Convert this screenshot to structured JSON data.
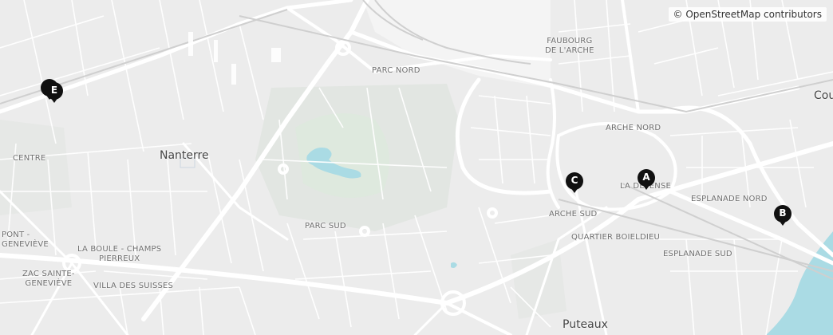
{
  "attribution": "© OpenStreetMap contributors",
  "labels": {
    "faubourg": [
      "FAUBOURG",
      "DE L'ARCHE"
    ],
    "parc_nord": "PARC NORD",
    "arche_nord": "ARCHE NORD",
    "nanterre": "Nanterre",
    "la_defense": "LA DÉFENSE",
    "arche_sud": "ARCHE SUD",
    "esplanade_nord": "ESPLANADE NORD",
    "quartier_boieldieu": "QUARTIER BOIELDIEU",
    "esplanade_sud": "ESPLANADE SUD",
    "parc_sud": "PARC SUD",
    "centre": "CENTRE",
    "pont": [
      "PONT -",
      "GENEVIÈVE"
    ],
    "la_boule": [
      "LA BOULE - CHAMPS",
      "PIERREUX"
    ],
    "zac": [
      "ZAC SAINTE-",
      "GENEVIÈVE"
    ],
    "villa": "VILLA DES SUISSES",
    "puteaux": "Puteaux",
    "courbevoie": "Cou"
  },
  "markers": [
    {
      "id": "A",
      "label": "A"
    },
    {
      "id": "B",
      "label": "B"
    },
    {
      "id": "C",
      "label": "C"
    },
    {
      "id": "D",
      "label": ""
    },
    {
      "id": "E",
      "label": "E"
    }
  ],
  "colors": {
    "marker": "#111111",
    "water": "#aadbe4",
    "park": "#dde3dd",
    "road": "#ffffff",
    "land": "#ececec"
  }
}
